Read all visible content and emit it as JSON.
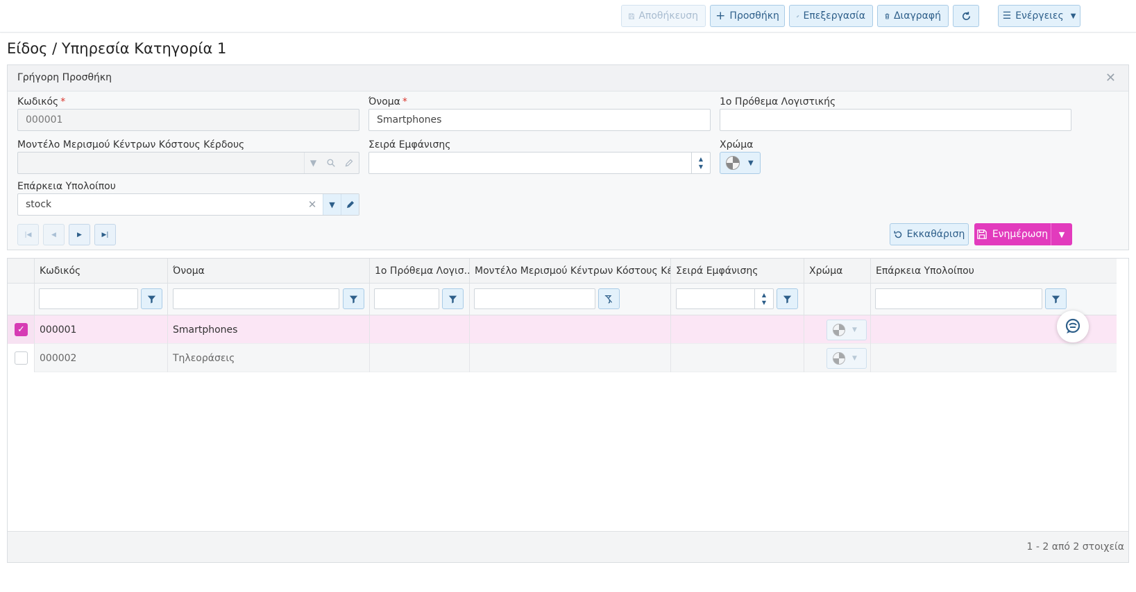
{
  "toolbar": {
    "save_label": "Αποθήκευση",
    "add_label": "Προσθήκη",
    "edit_label": "Επεξεργασία",
    "delete_label": "Διαγραφή",
    "actions_label": "Ενέργειες"
  },
  "page": {
    "title": "Είδος / Υπηρεσία Κατηγορία 1"
  },
  "quick_add": {
    "title": "Γρήγορη Προσθήκη",
    "code_label": "Κωδικός",
    "code_value": "000001",
    "name_label": "Όνομα",
    "name_value": "Smartphones",
    "prefix_label": "1ο Πρόθεμα Λογιστικής",
    "prefix_value": "",
    "model_label": "Μοντέλο Μερισμού Κέντρων Κόστους Κέρδους",
    "model_value": "",
    "order_label": "Σειρά Εμφάνισης",
    "order_value": "",
    "color_label": "Χρώμα",
    "balance_label": "Επάρκεια Υπολοίπου",
    "balance_value": "stock",
    "clear_label": "Εκκαθάριση",
    "update_label": "Ενημέρωση",
    "required_mark": "*"
  },
  "grid": {
    "columns": [
      "Κωδικός",
      "Όνομα",
      "1ο Πρόθεμα Λογισ...",
      "Μοντέλο Μερισμού Κέντρων Κόστους Κέρ...",
      "Σειρά Εμφάνισης",
      "Χρώμα",
      "Επάρκεια Υπολοίπου"
    ],
    "rows": [
      {
        "code": "000001",
        "name": "Smartphones",
        "prefix": "",
        "model": "",
        "order": "",
        "balance": "",
        "selected": true
      },
      {
        "code": "000002",
        "name": "Τηλεοράσεις",
        "prefix": "",
        "model": "",
        "order": "",
        "balance": "",
        "selected": false
      }
    ],
    "pager_text": "1 - 2 από 2 στοιχεία"
  },
  "colors": {
    "accent": "#e23bbd",
    "primary_light": "#e3f1fb",
    "primary_text": "#2e5f8a"
  }
}
